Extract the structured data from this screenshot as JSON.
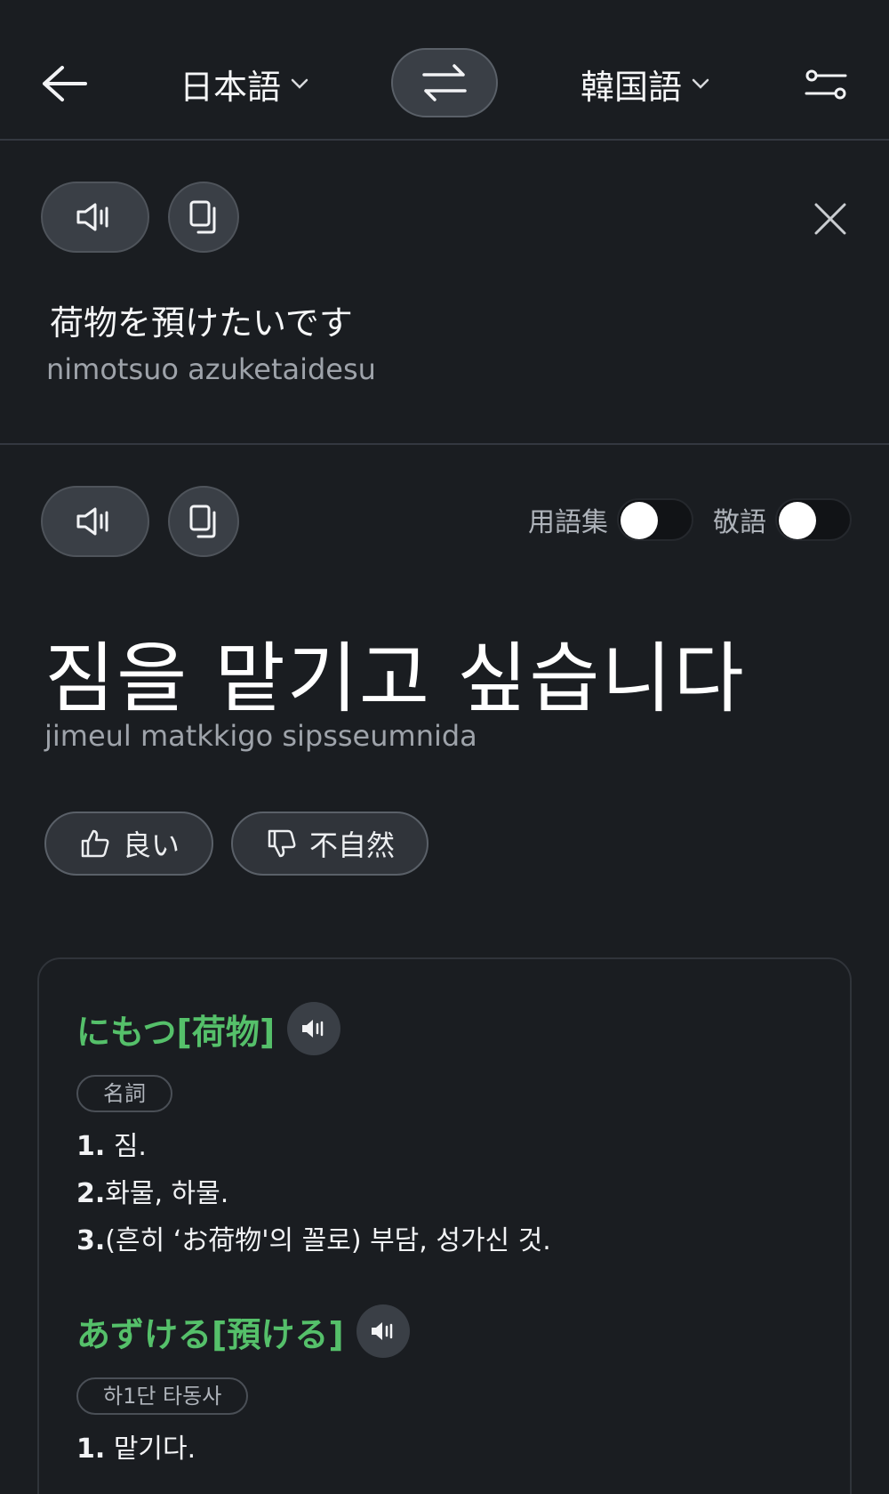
{
  "header": {
    "source_lang": "日本語",
    "target_lang": "韓国語"
  },
  "source": {
    "text": "荷物を預けたいです",
    "romanization": "nimotsuo azuketaidesu"
  },
  "target": {
    "text": "짐을 맡기고 싶습니다",
    "romanization": "jimeul matkkigo sipsseumnida",
    "glossary_label": "用語集",
    "honorific_label": "敬語",
    "glossary_on": false,
    "honorific_on": false
  },
  "feedback": {
    "good_label": "良い",
    "unnatural_label": "不自然"
  },
  "dictionary": {
    "entries": [
      {
        "headword": "にもつ[荷物]",
        "pos": "名詞",
        "definitions": [
          {
            "num": "1.",
            "text": " 짐."
          },
          {
            "num": "2.",
            "text": "화물, 하물."
          },
          {
            "num": "3.",
            "text": "(흔히 ‘お荷物'의 꼴로) 부담, 성가신 것."
          }
        ]
      },
      {
        "headword": "あずける[預ける]",
        "pos": "하1단 타동사",
        "definitions": [
          {
            "num": "1.",
            "text": " 맡기다."
          }
        ]
      }
    ]
  },
  "icons": {
    "back": "arrow-left-icon",
    "swap": "swap-arrows-icon",
    "settings": "sliders-icon",
    "speaker": "speaker-icon",
    "copy": "copy-icon",
    "close": "close-icon",
    "thumbs_up": "thumbs-up-icon",
    "thumbs_down": "thumbs-down-icon",
    "chevron": "chevron-down-icon"
  }
}
